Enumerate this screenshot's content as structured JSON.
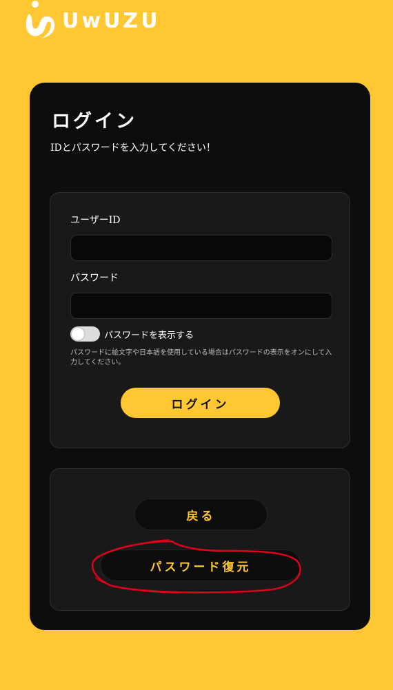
{
  "header": {
    "logo_text": "UwUZU"
  },
  "login": {
    "title": "ログイン",
    "subtitle": "IDとパスワードを入力してください！",
    "userid_label": "ユーザーID",
    "userid_value": "",
    "password_label": "パスワード",
    "password_value": "",
    "show_password_label": "パスワードを表示する",
    "show_password_on": false,
    "note": "パスワードに絵文字や日本語を使用している場合はパスワードの表示をオンにして入力してください。",
    "submit_label": "ログイン"
  },
  "actions": {
    "back_label": "戻る",
    "recover_label": "パスワード復元"
  },
  "colors": {
    "background": "#ffc832",
    "card": "#0d0d0d",
    "panel": "#1a1919",
    "accent": "#ffc832",
    "annotation": "#e0001a"
  }
}
